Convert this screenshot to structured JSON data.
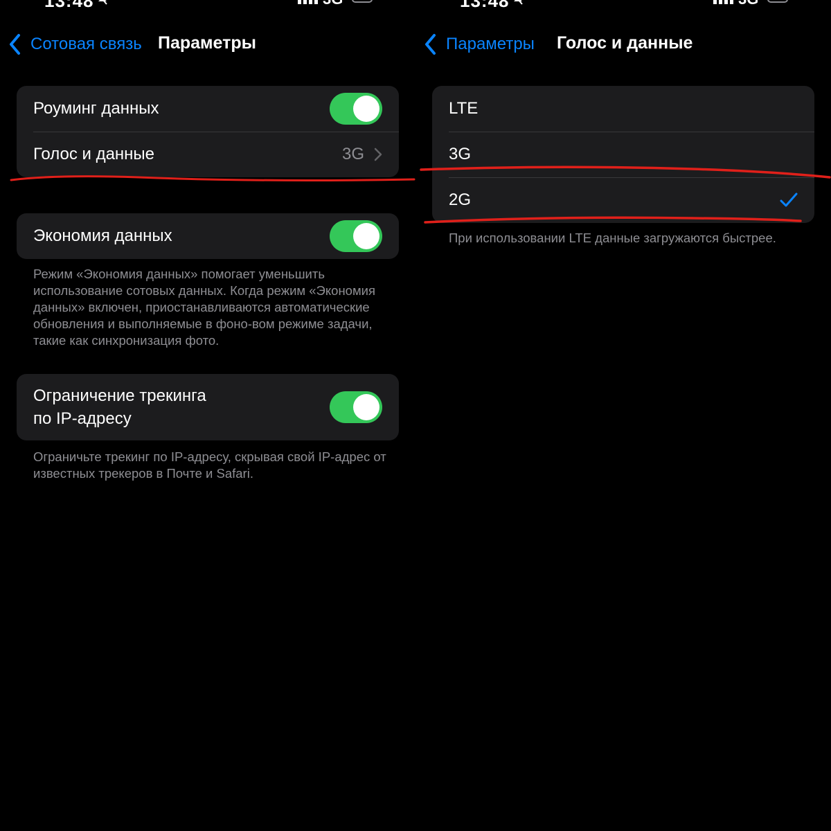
{
  "colors": {
    "background": "#000000",
    "cell": "#1c1c1e",
    "accent": "#0a84ff",
    "toggle_on": "#34c759",
    "secondary_text": "#8e8e93",
    "annotation": "#e0201a"
  },
  "left": {
    "status": {
      "time": "13:48",
      "network": "3G"
    },
    "nav": {
      "back_label": "Сотовая связь",
      "title": "Параметры"
    },
    "group1": {
      "roaming_label": "Роуминг данных",
      "roaming_on": true,
      "voice_data_label": "Голос и данные",
      "voice_data_value": "3G"
    },
    "group2": {
      "data_saver_label": "Экономия данных",
      "data_saver_on": true,
      "footnote": "Режим «Экономия данных» помогает уменьшить использование сотовых данных. Когда режим «Экономия данных» включен, приостанавливаются автоматические обновления и выполняемые в фоно-вом режиме задачи, такие как синхронизация фото."
    },
    "group3": {
      "ip_tracking_line1": "Ограничение трекинга",
      "ip_tracking_line2": "по IP-адресу",
      "ip_tracking_on": true,
      "footnote": "Ограничьте трекинг по IP-адресу, скрывая свой IP-адрес от известных трекеров в Почте и Safari."
    }
  },
  "right": {
    "status": {
      "time": "13:48",
      "network": "3G"
    },
    "nav": {
      "back_label": "Параметры",
      "title": "Голос и данные"
    },
    "options": [
      {
        "label": "LTE",
        "selected": false
      },
      {
        "label": "3G",
        "selected": false
      },
      {
        "label": "2G",
        "selected": true
      }
    ],
    "footnote": "При использовании LTE данные загружаются быстрее."
  }
}
